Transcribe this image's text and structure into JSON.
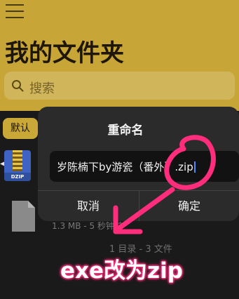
{
  "header": {
    "title": "我的文件夹",
    "search_placeholder": "搜索",
    "menu_icon": "hamburger-menu-icon",
    "search_icon": "magnifier-icon"
  },
  "toolbar": {
    "sort_label": "默认"
  },
  "files": [
    {
      "icon": "zip-archive-icon",
      "icon_label": "DZIP"
    },
    {
      "icon": "document-icon",
      "meta": "1.3 MB - 5 秒钟前"
    }
  ],
  "folder_summary": "1 目录 - 3 文件",
  "dialog": {
    "title": "重命名",
    "input_value": "岁陈楠下by游瓷（番外）.zip",
    "cancel_label": "取消",
    "confirm_label": "确定"
  },
  "annotation": {
    "caption": "exe改为zip",
    "color": "#ff2d7c"
  },
  "colors": {
    "header_bg": "#c7a536",
    "dialog_bg": "#2b2b2b",
    "accent": "#caa837"
  }
}
